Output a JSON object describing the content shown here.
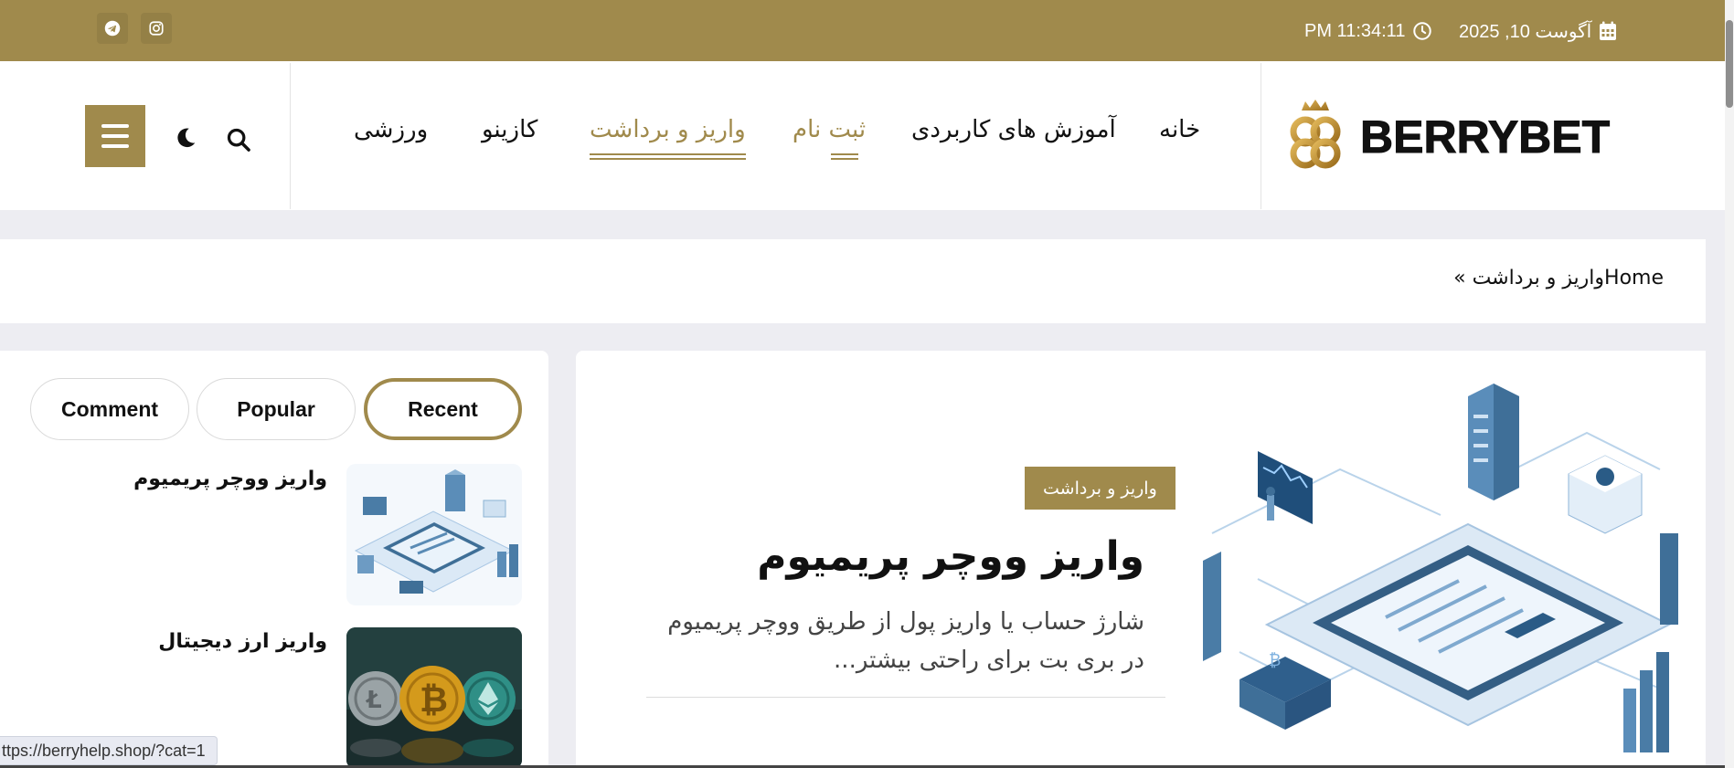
{
  "topbar": {
    "date": "آگوست 10, 2025",
    "time": "PM 11:34:11",
    "social": [
      "telegram-icon",
      "instagram-icon"
    ],
    "color": "#a08a4c"
  },
  "header": {
    "logo_text": "BERRYBET",
    "nav": [
      {
        "label": "خانه",
        "active": false
      },
      {
        "label": "آموزش های کاربردی",
        "active": false
      },
      {
        "label": "ثبت نام",
        "active": true
      },
      {
        "label": "واریز و برداشت",
        "active": true
      },
      {
        "label": "کازینو",
        "active": false
      },
      {
        "label": "ورزشی",
        "active": false
      }
    ],
    "icons": [
      "search-icon",
      "moon-icon",
      "hamburger-icon"
    ]
  },
  "breadcrumb": {
    "text": "« واریز و برداشتHome"
  },
  "featured": {
    "category": "واریز و برداشت",
    "title": "واریز ووچر پریمیوم",
    "excerpt": "شارژ حساب یا واریز پول از طریق ووچر پریمیوم در بری بت برای راحتی بیشتر..."
  },
  "sidebar": {
    "tabs": [
      "Comment",
      "Popular",
      "Recent"
    ],
    "active_tab": "Recent",
    "posts": [
      {
        "title": "واریز ووچر پریمیوم"
      },
      {
        "title": "واریز ارز دیجیتال"
      }
    ]
  },
  "status_url": "ttps://berryhelp.shop/?cat=1",
  "accent": "#a08a4c"
}
